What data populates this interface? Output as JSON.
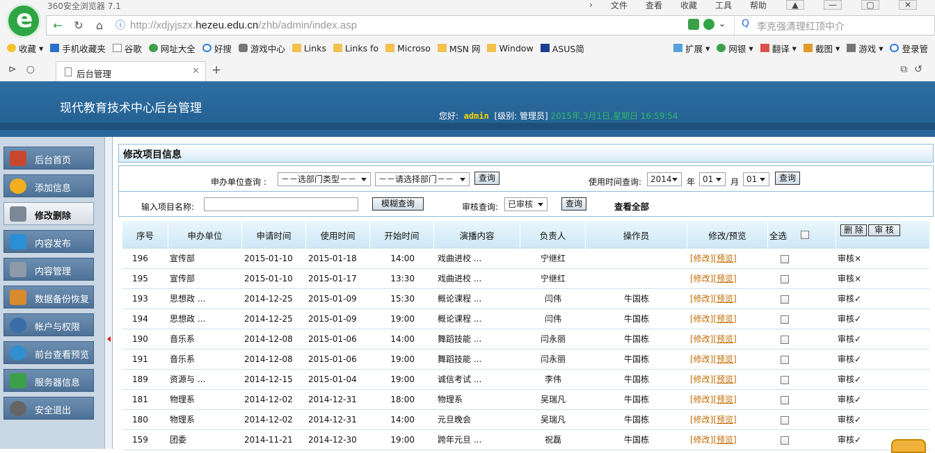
{
  "browser": {
    "app_title": "360安全浏览器 7.1",
    "menu": [
      "文件",
      "查看",
      "收藏",
      "工具",
      "帮助"
    ],
    "url_prefix": "http://xdjyjszx.",
    "url_domain": "hezeu.edu.cn",
    "url_path": "/zhb/admin/index.asp",
    "search_placeholder": "李克强清理红顶中介",
    "bookmarks": [
      "收藏",
      "手机收藏夹",
      "谷歌",
      "网址大全",
      "好搜",
      "游戏中心",
      "Links",
      "Links fo",
      "Microso",
      "MSN 网",
      "Window",
      "ASUS简"
    ],
    "toolbar_right": [
      "扩展",
      "网银",
      "翻译",
      "截图",
      "游戏",
      "登录管"
    ],
    "tab_title": "后台管理"
  },
  "header": {
    "title": "现代教育技术中心后台管理",
    "greeting_prefix": "您好:",
    "user": "admin",
    "role": "[级别: 管理员]",
    "date": "2015年,3月1日,星期日 16:59:54"
  },
  "sidebar": {
    "items": [
      {
        "label": "后台首页",
        "icon": "house-icon",
        "color": "#c9472f"
      },
      {
        "label": "添加信息",
        "icon": "speech-bubble-icon",
        "color": "#f2b01e"
      },
      {
        "label": "修改删除",
        "icon": "tools-icon",
        "color": "#7d8896"
      },
      {
        "label": "内容发布",
        "icon": "screen-icon",
        "color": "#2b8fd6"
      },
      {
        "label": "内容管理",
        "icon": "wrench-icon",
        "color": "#8e9aa8"
      },
      {
        "label": "数据备份恢复",
        "icon": "disk-icon",
        "color": "#d98a2c"
      },
      {
        "label": "帐户与权限",
        "icon": "user-icon",
        "color": "#3a6ea8"
      },
      {
        "label": "前台查看预览",
        "icon": "globe-icon",
        "color": "#2f8fcf"
      },
      {
        "label": "服务器信息",
        "icon": "board-icon",
        "color": "#3ca04a"
      },
      {
        "label": "安全退出",
        "icon": "power-icon",
        "color": "#666666"
      }
    ]
  },
  "main": {
    "section_title": "修改项目信息",
    "filters": {
      "unit_label": "申办单位查询 :",
      "dept_type": "－－选部门类型－－",
      "dept": "－－请选择部门－－",
      "query_btn": "查询",
      "time_label": "使用时间查询:",
      "year": "2014",
      "year_unit": "年",
      "month": "01",
      "month_unit": "月",
      "day": "01",
      "query_btn2": "查询",
      "name_label": "输入项目名称:",
      "name_value": "",
      "fuzzy_btn": "模糊查询",
      "audit_label": "审核查询:",
      "audit_value": "已审核",
      "query_btn3": "查询",
      "view_all": "查看全部"
    },
    "table": {
      "headers": [
        "序号",
        "申办单位",
        "申请时间",
        "使用时间",
        "开始时间",
        "演播内容",
        "负责人",
        "操作员",
        "修改/预览",
        "全选"
      ],
      "delete_btn": "删 除",
      "audit_btn": "审 核",
      "rows": [
        {
          "id": "196",
          "unit": "宣传部",
          "apply": "2015-01-10",
          "use": "2015-01-18",
          "start": "14:00",
          "content": "戏曲进校 ...",
          "owner": "宁继红",
          "operator": "",
          "edit": "[修改]",
          "preview": "[预览]",
          "status": "审核×"
        },
        {
          "id": "195",
          "unit": "宣传部",
          "apply": "2015-01-10",
          "use": "2015-01-17",
          "start": "13:30",
          "content": "戏曲进校 ...",
          "owner": "宁继红",
          "operator": "",
          "edit": "[修改]",
          "preview": "[预览]",
          "status": "审核×"
        },
        {
          "id": "193",
          "unit": "思想政 ...",
          "apply": "2014-12-25",
          "use": "2015-01-09",
          "start": "15:30",
          "content": "概论课程 ...",
          "owner": "闫伟",
          "operator": "牛国栋",
          "edit": "[修改]",
          "preview": "[预览]",
          "status": "审核✓"
        },
        {
          "id": "194",
          "unit": "思想政 ...",
          "apply": "2014-12-25",
          "use": "2015-01-09",
          "start": "19:00",
          "content": "概论课程 ...",
          "owner": "闫伟",
          "operator": "牛国栋",
          "edit": "[修改]",
          "preview": "[预览]",
          "status": "审核✓"
        },
        {
          "id": "190",
          "unit": "音乐系",
          "apply": "2014-12-08",
          "use": "2015-01-06",
          "start": "14:00",
          "content": "舞蹈技能 ...",
          "owner": "闫永丽",
          "operator": "牛国栋",
          "edit": "[修改]",
          "preview": "[预览]",
          "status": "审核✓"
        },
        {
          "id": "191",
          "unit": "音乐系",
          "apply": "2014-12-08",
          "use": "2015-01-06",
          "start": "19:00",
          "content": "舞蹈技能 ...",
          "owner": "闫永丽",
          "operator": "牛国栋",
          "edit": "[修改]",
          "preview": "[预览]",
          "status": "审核✓"
        },
        {
          "id": "189",
          "unit": "资源与 ...",
          "apply": "2014-12-15",
          "use": "2015-01-04",
          "start": "19:00",
          "content": "诚信考试 ...",
          "owner": "李伟",
          "operator": "牛国栋",
          "edit": "[修改]",
          "preview": "[预览]",
          "status": "审核✓"
        },
        {
          "id": "181",
          "unit": "物理系",
          "apply": "2014-12-02",
          "use": "2014-12-31",
          "start": "18:00",
          "content": "物理系",
          "owner": "吴瑞凡",
          "operator": "牛国栋",
          "edit": "[修改]",
          "preview": "[预览]",
          "status": "审核✓"
        },
        {
          "id": "180",
          "unit": "物理系",
          "apply": "2014-12-02",
          "use": "2014-12-31",
          "start": "14:00",
          "content": "元旦晚会",
          "owner": "吴瑞凡",
          "operator": "牛国栋",
          "edit": "[修改]",
          "preview": "[预览]",
          "status": "审核✓"
        },
        {
          "id": "159",
          "unit": "团委",
          "apply": "2014-11-21",
          "use": "2014-12-30",
          "start": "19:00",
          "content": "跨年元旦 ...",
          "owner": "祝磊",
          "operator": "牛国栋",
          "edit": "[修改]",
          "preview": "[预览]",
          "status": "审核✓"
        }
      ]
    }
  }
}
